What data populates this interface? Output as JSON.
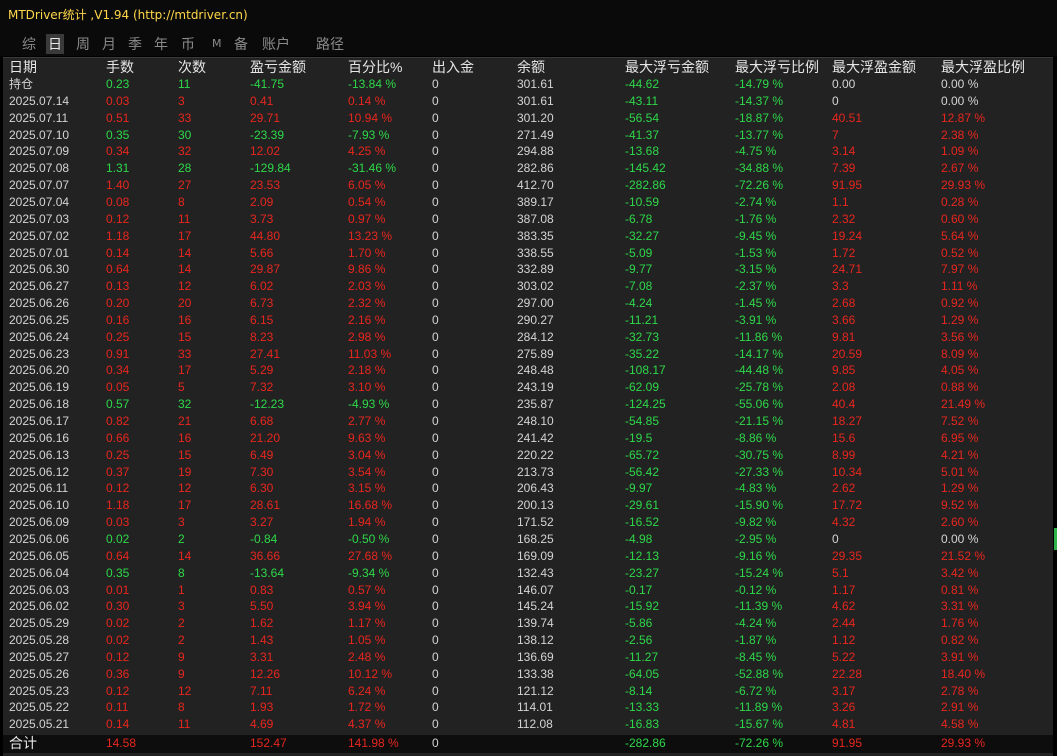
{
  "window": {
    "title": "MTDriver统计 ,V1.94 (http://mtdriver.cn)"
  },
  "tabs": [
    {
      "label": "综",
      "active": false
    },
    {
      "label": "日",
      "active": true
    },
    {
      "label": "周",
      "active": false
    },
    {
      "label": "月",
      "active": false
    },
    {
      "label": "季",
      "active": false
    },
    {
      "label": "年",
      "active": false
    },
    {
      "label": "币",
      "active": false
    },
    {
      "label": "M",
      "active": false
    },
    {
      "label": "备",
      "active": false
    },
    {
      "label": "账户",
      "active": false
    },
    {
      "label": "路径",
      "active": false
    }
  ],
  "columns": [
    "日期",
    "手数",
    "次数",
    "盈亏金额",
    "百分比%",
    "出入金",
    "余额",
    "最大浮亏金额",
    "最大浮亏比例",
    "最大浮盈金额",
    "最大浮盈比例"
  ],
  "colors": {
    "profit": "#e8261e",
    "loss": "#2ed84a",
    "neutral": "#d4d4d4",
    "title": "#ffd84a"
  },
  "rows": [
    {
      "tone": "green",
      "cells": [
        "持仓",
        "0.23",
        "11",
        "-41.75",
        "-13.84 %",
        "0",
        "301.61",
        "-44.62",
        "-14.79 %",
        "0.00",
        "0.00 %"
      ]
    },
    {
      "tone": "red",
      "cells": [
        "2025.07.14",
        "0.03",
        "3",
        "0.41",
        "0.14 %",
        "0",
        "301.61",
        "-43.11",
        "-14.37 %",
        "0",
        "0.00 %"
      ]
    },
    {
      "tone": "red",
      "cells": [
        "2025.07.11",
        "0.51",
        "33",
        "29.71",
        "10.94 %",
        "0",
        "301.20",
        "-56.54",
        "-18.87 %",
        "40.51",
        "12.87 %"
      ]
    },
    {
      "tone": "green",
      "cells": [
        "2025.07.10",
        "0.35",
        "30",
        "-23.39",
        "-7.93 %",
        "0",
        "271.49",
        "-41.37",
        "-13.77 %",
        "7",
        "2.38 %"
      ]
    },
    {
      "tone": "red",
      "cells": [
        "2025.07.09",
        "0.34",
        "32",
        "12.02",
        "4.25 %",
        "0",
        "294.88",
        "-13.68",
        "-4.75 %",
        "3.14",
        "1.09 %"
      ]
    },
    {
      "tone": "green",
      "cells": [
        "2025.07.08",
        "1.31",
        "28",
        "-129.84",
        "-31.46 %",
        "0",
        "282.86",
        "-145.42",
        "-34.88 %",
        "7.39",
        "2.67 %"
      ]
    },
    {
      "tone": "red",
      "cells": [
        "2025.07.07",
        "1.40",
        "27",
        "23.53",
        "6.05 %",
        "0",
        "412.70",
        "-282.86",
        "-72.26 %",
        "91.95",
        "29.93 %"
      ]
    },
    {
      "tone": "red",
      "cells": [
        "2025.07.04",
        "0.08",
        "8",
        "2.09",
        "0.54 %",
        "0",
        "389.17",
        "-10.59",
        "-2.74 %",
        "1.1",
        "0.28 %"
      ]
    },
    {
      "tone": "red",
      "cells": [
        "2025.07.03",
        "0.12",
        "11",
        "3.73",
        "0.97 %",
        "0",
        "387.08",
        "-6.78",
        "-1.76 %",
        "2.32",
        "0.60 %"
      ]
    },
    {
      "tone": "red",
      "cells": [
        "2025.07.02",
        "1.18",
        "17",
        "44.80",
        "13.23 %",
        "0",
        "383.35",
        "-32.27",
        "-9.45 %",
        "19.24",
        "5.64 %"
      ]
    },
    {
      "tone": "red",
      "cells": [
        "2025.07.01",
        "0.14",
        "14",
        "5.66",
        "1.70 %",
        "0",
        "338.55",
        "-5.09",
        "-1.53 %",
        "1.72",
        "0.52 %"
      ]
    },
    {
      "tone": "red",
      "cells": [
        "2025.06.30",
        "0.64",
        "14",
        "29.87",
        "9.86 %",
        "0",
        "332.89",
        "-9.77",
        "-3.15 %",
        "24.71",
        "7.97 %"
      ]
    },
    {
      "tone": "red",
      "cells": [
        "2025.06.27",
        "0.13",
        "12",
        "6.02",
        "2.03 %",
        "0",
        "303.02",
        "-7.08",
        "-2.37 %",
        "3.3",
        "1.11 %"
      ]
    },
    {
      "tone": "red",
      "cells": [
        "2025.06.26",
        "0.20",
        "20",
        "6.73",
        "2.32 %",
        "0",
        "297.00",
        "-4.24",
        "-1.45 %",
        "2.68",
        "0.92 %"
      ]
    },
    {
      "tone": "red",
      "cells": [
        "2025.06.25",
        "0.16",
        "16",
        "6.15",
        "2.16 %",
        "0",
        "290.27",
        "-11.21",
        "-3.91 %",
        "3.66",
        "1.29 %"
      ]
    },
    {
      "tone": "red",
      "cells": [
        "2025.06.24",
        "0.25",
        "15",
        "8.23",
        "2.98 %",
        "0",
        "284.12",
        "-32.73",
        "-11.86 %",
        "9.81",
        "3.56 %"
      ]
    },
    {
      "tone": "red",
      "cells": [
        "2025.06.23",
        "0.91",
        "33",
        "27.41",
        "11.03 %",
        "0",
        "275.89",
        "-35.22",
        "-14.17 %",
        "20.59",
        "8.09 %"
      ]
    },
    {
      "tone": "red",
      "cells": [
        "2025.06.20",
        "0.34",
        "17",
        "5.29",
        "2.18 %",
        "0",
        "248.48",
        "-108.17",
        "-44.48 %",
        "9.85",
        "4.05 %"
      ]
    },
    {
      "tone": "red",
      "cells": [
        "2025.06.19",
        "0.05",
        "5",
        "7.32",
        "3.10 %",
        "0",
        "243.19",
        "-62.09",
        "-25.78 %",
        "2.08",
        "0.88 %"
      ]
    },
    {
      "tone": "green",
      "cells": [
        "2025.06.18",
        "0.57",
        "32",
        "-12.23",
        "-4.93 %",
        "0",
        "235.87",
        "-124.25",
        "-55.06 %",
        "40.4",
        "21.49 %"
      ]
    },
    {
      "tone": "red",
      "cells": [
        "2025.06.17",
        "0.82",
        "21",
        "6.68",
        "2.77 %",
        "0",
        "248.10",
        "-54.85",
        "-21.15 %",
        "18.27",
        "7.52 %"
      ]
    },
    {
      "tone": "red",
      "cells": [
        "2025.06.16",
        "0.66",
        "16",
        "21.20",
        "9.63 %",
        "0",
        "241.42",
        "-19.5",
        "-8.86 %",
        "15.6",
        "6.95 %"
      ]
    },
    {
      "tone": "red",
      "cells": [
        "2025.06.13",
        "0.25",
        "15",
        "6.49",
        "3.04 %",
        "0",
        "220.22",
        "-65.72",
        "-30.75 %",
        "8.99",
        "4.21 %"
      ]
    },
    {
      "tone": "red",
      "cells": [
        "2025.06.12",
        "0.37",
        "19",
        "7.30",
        "3.54 %",
        "0",
        "213.73",
        "-56.42",
        "-27.33 %",
        "10.34",
        "5.01 %"
      ]
    },
    {
      "tone": "red",
      "cells": [
        "2025.06.11",
        "0.12",
        "12",
        "6.30",
        "3.15 %",
        "0",
        "206.43",
        "-9.97",
        "-4.83 %",
        "2.62",
        "1.29 %"
      ]
    },
    {
      "tone": "red",
      "cells": [
        "2025.06.10",
        "1.18",
        "17",
        "28.61",
        "16.68 %",
        "0",
        "200.13",
        "-29.61",
        "-15.90 %",
        "17.72",
        "9.52 %"
      ]
    },
    {
      "tone": "red",
      "cells": [
        "2025.06.09",
        "0.03",
        "3",
        "3.27",
        "1.94 %",
        "0",
        "171.52",
        "-16.52",
        "-9.82 %",
        "4.32",
        "2.60 %"
      ]
    },
    {
      "tone": "green",
      "cells": [
        "2025.06.06",
        "0.02",
        "2",
        "-0.84",
        "-0.50 %",
        "0",
        "168.25",
        "-4.98",
        "-2.95 %",
        "0",
        "0.00 %"
      ]
    },
    {
      "tone": "red",
      "cells": [
        "2025.06.05",
        "0.64",
        "14",
        "36.66",
        "27.68 %",
        "0",
        "169.09",
        "-12.13",
        "-9.16 %",
        "29.35",
        "21.52 %"
      ]
    },
    {
      "tone": "green",
      "cells": [
        "2025.06.04",
        "0.35",
        "8",
        "-13.64",
        "-9.34 %",
        "0",
        "132.43",
        "-23.27",
        "-15.24 %",
        "5.1",
        "3.42 %"
      ]
    },
    {
      "tone": "red",
      "cells": [
        "2025.06.03",
        "0.01",
        "1",
        "0.83",
        "0.57 %",
        "0",
        "146.07",
        "-0.17",
        "-0.12 %",
        "1.17",
        "0.81 %"
      ]
    },
    {
      "tone": "red",
      "cells": [
        "2025.06.02",
        "0.30",
        "3",
        "5.50",
        "3.94 %",
        "0",
        "145.24",
        "-15.92",
        "-11.39 %",
        "4.62",
        "3.31 %"
      ]
    },
    {
      "tone": "red",
      "cells": [
        "2025.05.29",
        "0.02",
        "2",
        "1.62",
        "1.17 %",
        "0",
        "139.74",
        "-5.86",
        "-4.24 %",
        "2.44",
        "1.76 %"
      ]
    },
    {
      "tone": "red",
      "cells": [
        "2025.05.28",
        "0.02",
        "2",
        "1.43",
        "1.05 %",
        "0",
        "138.12",
        "-2.56",
        "-1.87 %",
        "1.12",
        "0.82 %"
      ]
    },
    {
      "tone": "red",
      "cells": [
        "2025.05.27",
        "0.12",
        "9",
        "3.31",
        "2.48 %",
        "0",
        "136.69",
        "-11.27",
        "-8.45 %",
        "5.22",
        "3.91 %"
      ]
    },
    {
      "tone": "red",
      "cells": [
        "2025.05.26",
        "0.36",
        "9",
        "12.26",
        "10.12 %",
        "0",
        "133.38",
        "-64.05",
        "-52.88 %",
        "22.28",
        "18.40 %"
      ]
    },
    {
      "tone": "red",
      "cells": [
        "2025.05.23",
        "0.12",
        "12",
        "7.11",
        "6.24 %",
        "0",
        "121.12",
        "-8.14",
        "-6.72 %",
        "3.17",
        "2.78 %"
      ]
    },
    {
      "tone": "red",
      "cells": [
        "2025.05.22",
        "0.11",
        "8",
        "1.93",
        "1.72 %",
        "0",
        "114.01",
        "-13.33",
        "-11.89 %",
        "3.26",
        "2.91 %"
      ]
    },
    {
      "tone": "red",
      "cells": [
        "2025.05.21",
        "0.14",
        "11",
        "4.69",
        "4.37 %",
        "0",
        "112.08",
        "-16.83",
        "-15.67 %",
        "4.81",
        "4.58 %"
      ]
    }
  ],
  "total": {
    "cells": [
      "合计",
      "14.58",
      "",
      "152.47",
      "141.98 %",
      "0",
      "",
      "-282.86",
      "-72.26 %",
      "91.95",
      "29.93 %"
    ]
  }
}
